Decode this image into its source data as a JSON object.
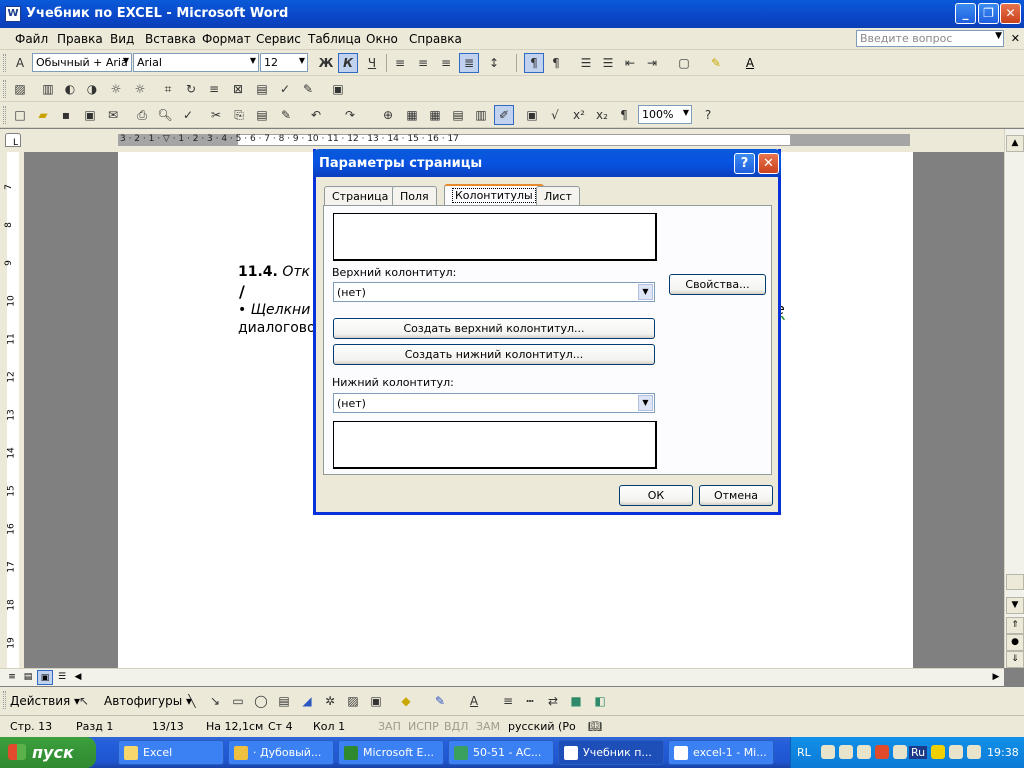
{
  "window": {
    "title": "Учебник по EXCEL - Microsoft Word",
    "app_icon": "W"
  },
  "menu": {
    "items": [
      "Файл",
      "Правка",
      "Вид",
      "Вставка",
      "Формат",
      "Сервис",
      "Таблица",
      "Окно",
      "Справка"
    ],
    "ask_placeholder": "Введите вопрос"
  },
  "formatting": {
    "style": "Обычный + Aria",
    "font": "Arial",
    "size": "12",
    "zoom": "100%",
    "bold": "Ж",
    "italic": "К",
    "underline": "Ч"
  },
  "ruler": {
    "numbers": "3 · 2 · 1 · ▽ · 1 · 2 · 3 · 4 · 5 · 6 · 7 · 8 · 9 · 10 · 11 · 12 · 13 · 14 · 15 · 16 · 17"
  },
  "vruler": [
    "7",
    "8",
    "9",
    "10",
    "11",
    "12",
    "13",
    "14",
    "15",
    "16",
    "17",
    "18",
    "19"
  ],
  "document": {
    "heading_num": "11.4.",
    "heading_text": "Отк",
    "cursor": "/",
    "bullet_text": "•   Щелкни",
    "line2": "диалогово",
    "tail": "е"
  },
  "dialog": {
    "title": "Параметры страницы",
    "tabs": [
      "Страница",
      "Поля",
      "Колонтитулы",
      "Лист"
    ],
    "selected_tab": "Колонтитулы",
    "header_label": "Верхний колонтитул:",
    "header_value": "(нет)",
    "properties_button": "Свойства...",
    "create_header_button": "Создать верхний колонтитул...",
    "create_footer_button": "Создать нижний колонтитул...",
    "footer_label": "Нижний колонтитул:",
    "footer_value": "(нет)",
    "ok": "ОК",
    "cancel": "Отмена"
  },
  "drawbar": {
    "actions": "Действия ▾",
    "autoshapes": "Автофигуры ▾"
  },
  "status": {
    "page": "Стр. 13",
    "section": "Разд 1",
    "pages": "13/13",
    "at": "На 12,1см",
    "line": "Ст 4",
    "col": "Кол 1",
    "rec": "ЗАП",
    "trk": "ИСПР",
    "ext": "ВДЛ",
    "ovr": "ЗАМ",
    "lang": "русский (Ро"
  },
  "taskbar": {
    "start": "пуск",
    "tasks": [
      "Excel",
      "· Дубовый...",
      "Microsoft E...",
      "50-51 - AC...",
      "Учебник п...",
      "excel-1 - Mi..."
    ],
    "lang": "RL",
    "kb": "Ru",
    "clock": "19:38"
  }
}
